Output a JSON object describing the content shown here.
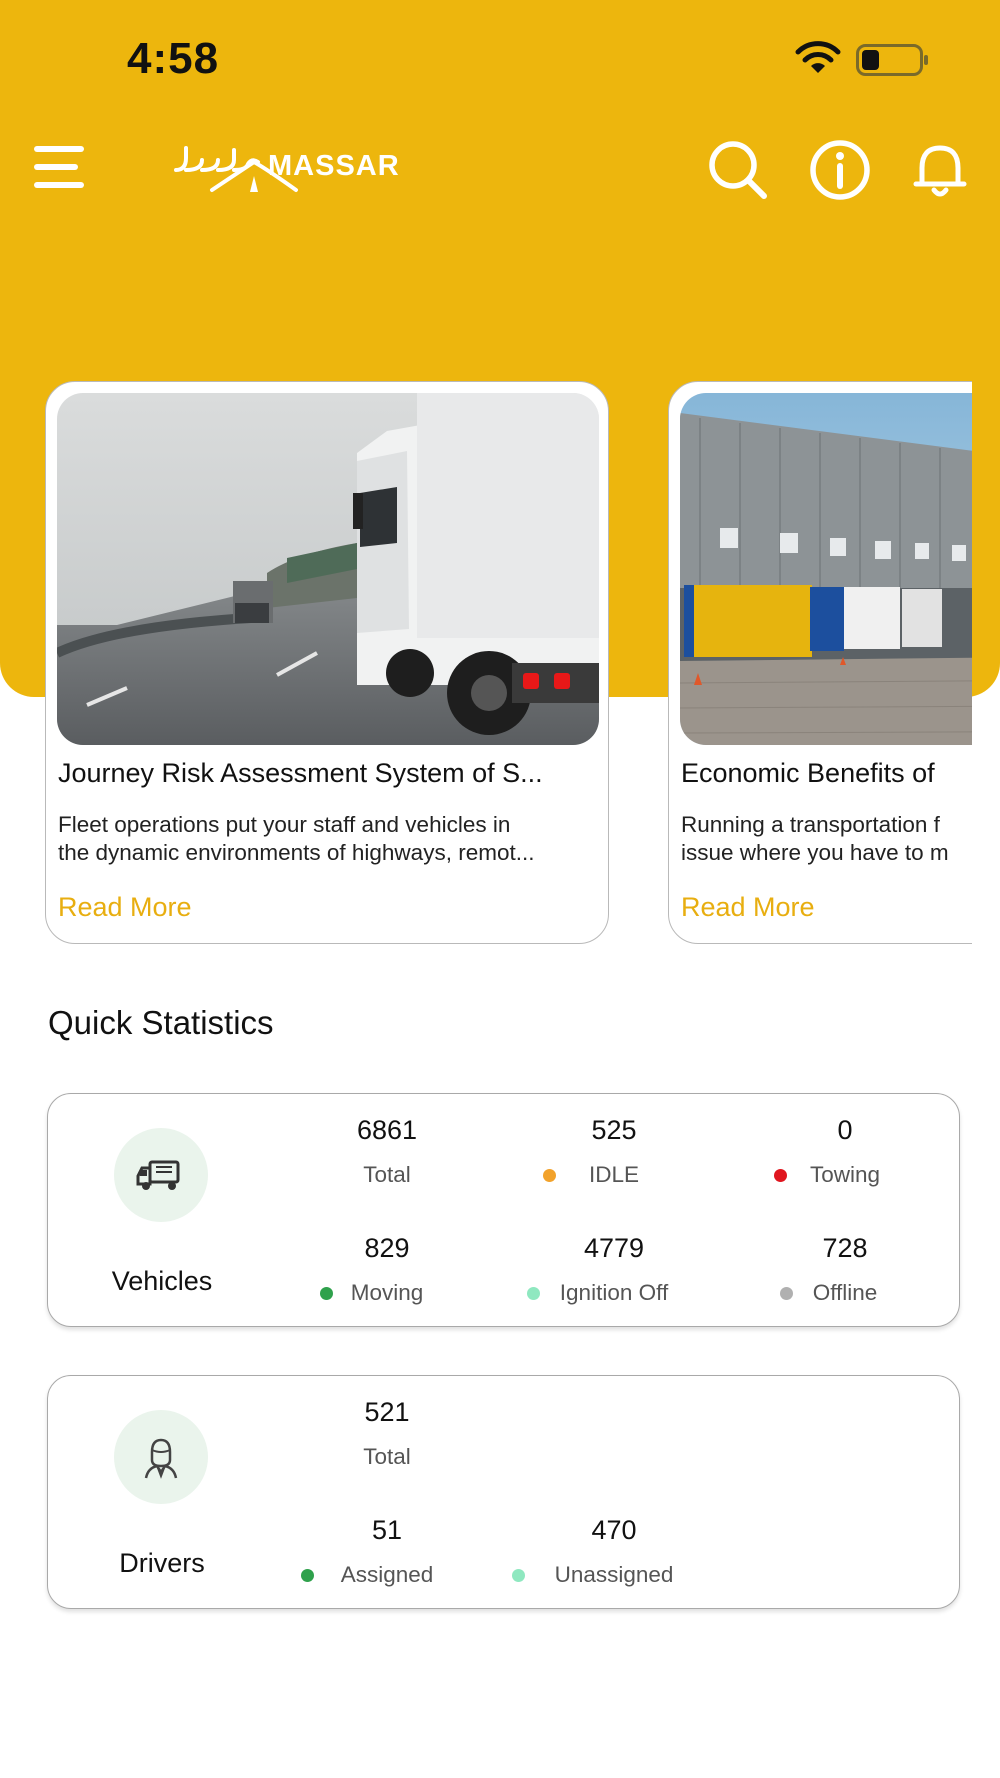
{
  "status_bar": {
    "time": "4:58"
  },
  "app": {
    "logo_text": "MASSAR"
  },
  "articles": [
    {
      "title": "Journey Risk Assessment System of S...",
      "desc_line1": "Fleet operations put your staff and vehicles in",
      "desc_line2": "the dynamic environments of highways, remot...",
      "link": "Read More"
    },
    {
      "title": "Economic Benefits of",
      "desc_line1": "Running a transportation f",
      "desc_line2": "issue where you have to m",
      "link": "Read More"
    }
  ],
  "quick_stats": {
    "title": "Quick Statistics",
    "vehicles": {
      "label": "Vehicles",
      "stats": [
        {
          "value": "6861",
          "label": "Total"
        },
        {
          "value": "525",
          "label": "IDLE",
          "dot_color": "#F2A22B"
        },
        {
          "value": "0",
          "label": "Towing",
          "dot_color": "#E0161F"
        },
        {
          "value": "829",
          "label": "Moving",
          "dot_color": "#2FA14C"
        },
        {
          "value": "4779",
          "label": "Ignition Off",
          "dot_color": "#8FE8C0"
        },
        {
          "value": "728",
          "label": "Offline",
          "dot_color": "#B0B0B0"
        }
      ]
    },
    "drivers": {
      "label": "Drivers",
      "stats": [
        {
          "value": "521",
          "label": "Total"
        },
        {
          "value": "51",
          "label": "Assigned",
          "dot_color": "#2FA14C"
        },
        {
          "value": "470",
          "label": "Unassigned",
          "dot_color": "#8FE8C0"
        }
      ]
    }
  },
  "colors": {
    "brand": "#EDB60D",
    "link": "#E8AE10"
  },
  "icons": [
    "menu-icon",
    "search-icon",
    "info-icon",
    "bell-icon",
    "truck-icon",
    "driver-icon",
    "wifi-icon",
    "battery-icon"
  ]
}
